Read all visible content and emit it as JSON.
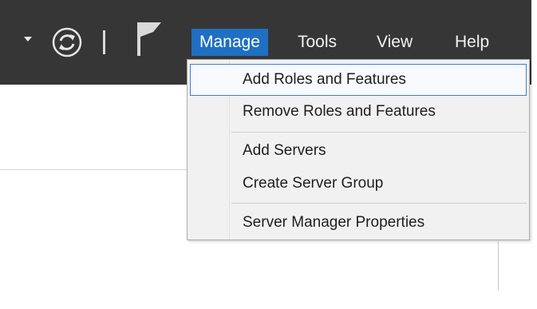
{
  "toolbar": {
    "icons": [
      "chevron-down-icon",
      "refresh-icon",
      "flag-icon"
    ]
  },
  "menubar": {
    "items": [
      {
        "label": "Manage",
        "active": true
      },
      {
        "label": "Tools"
      },
      {
        "label": "View"
      },
      {
        "label": "Help"
      }
    ]
  },
  "manage_menu": {
    "items": [
      {
        "label": "Add Roles and Features",
        "highlighted": true
      },
      {
        "label": "Remove Roles and Features"
      },
      {
        "label": "Add Servers"
      },
      {
        "label": "Create Server Group"
      },
      {
        "label": "Server Manager Properties"
      }
    ]
  },
  "colors": {
    "toolbar_bg": "#363636",
    "active_menu_bg": "#1f6fc3",
    "dropdown_bg": "#f1f1f1",
    "highlight_border": "#3f7fcf"
  }
}
